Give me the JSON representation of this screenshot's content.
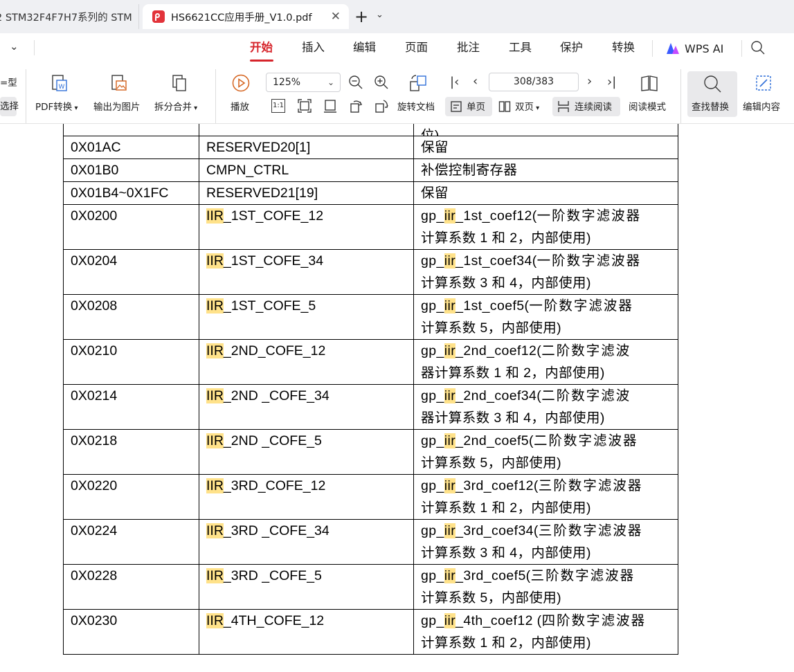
{
  "tabs": [
    {
      "label": "2 STM32F4F7H7系列的 STM",
      "active": false
    },
    {
      "label": "HS6621CC应用手册_V1.0.pdf",
      "active": true
    }
  ],
  "menu": [
    "开始",
    "插入",
    "编辑",
    "页面",
    "批注",
    "工具",
    "保护",
    "转换"
  ],
  "menu_active": "开始",
  "wps_ai": "WPS AI",
  "toolbar": {
    "left_cut_top": "=型",
    "left_cut_bottom": "选择",
    "pdf_convert": "PDF转换",
    "export_image": "输出为图片",
    "split_merge": "拆分合并",
    "play": "播放",
    "zoom": "125%",
    "rotate": "旋转文档",
    "page_indicator": "308/383",
    "single_page": "单页",
    "double_page": "双页",
    "continuous": "连续阅读",
    "read_mode": "阅读模式",
    "find_replace": "查找替换",
    "edit_content": "编辑内容",
    "actual_size": "1:1"
  },
  "cut_row_desc": "位)",
  "rows": [
    {
      "addr": "0X01AC",
      "name_hl": "",
      "name": "RESERVED20[1]",
      "d1": "保留",
      "hl": "",
      "d2": "",
      "d3": ""
    },
    {
      "addr": "0X01B0",
      "name_hl": "",
      "name": "CMPN_CTRL",
      "d1": "补偿控制寄存器",
      "hl": "",
      "d2": "",
      "d3": ""
    },
    {
      "addr": "0X01B4~0X1FC",
      "name_hl": "",
      "name": "RESERVED21[19]",
      "d1": "保留",
      "hl": "",
      "d2": "",
      "d3": ""
    },
    {
      "addr": "0X0200",
      "name_hl": "IIR",
      "name": "_1ST_COFE_12",
      "d1": "gp_",
      "hl": "iir",
      "d2": "_1st_coef12(",
      "d3": "一阶数字滤波器",
      "line2": "计算系数 1 和 2，内部使用)"
    },
    {
      "addr": "0X0204",
      "name_hl": "IIR",
      "name": "_1ST_COFE_34",
      "d1": "gp_",
      "hl": "iir",
      "d2": "_1st_coef34(",
      "d3": "一阶数字滤波器",
      "line2": "计算系数 3 和 4，内部使用)"
    },
    {
      "addr": "0X0208",
      "name_hl": "IIR",
      "name": "_1ST_COFE_5",
      "d1": "gp_",
      "hl": "iir",
      "d2": "_1st_coef5(",
      "d3": "一阶数字滤波器",
      "line2": "计算系数 5，内部使用)"
    },
    {
      "addr": "0X0210",
      "name_hl": "IIR",
      "name": "_2ND_COFE_12",
      "d1": "gp_",
      "hl": "iir",
      "d2": "_2nd_coef12(",
      "d3": "二阶数字滤波",
      "line2": "器计算系数 1 和 2，内部使用)"
    },
    {
      "addr": "0X0214",
      "name_hl": "IIR",
      "name": "_2ND _COFE_34",
      "d1": "gp_",
      "hl": "iir",
      "d2": "_2nd_coef34(",
      "d3": "二阶数字滤波",
      "line2": "器计算系数 3 和 4，内部使用)"
    },
    {
      "addr": "0X0218",
      "name_hl": "IIR",
      "name": "_2ND _COFE_5",
      "d1": "gp_",
      "hl": "iir",
      "d2": "_2nd_coef5(",
      "d3": "二阶数字滤波器",
      "line2": "计算系数 5，内部使用)"
    },
    {
      "addr": "0X0220",
      "name_hl": "IIR",
      "name": "_3RD_COFE_12",
      "d1": "gp_",
      "hl": "iir",
      "d2": "_3rd_coef12(",
      "d3": "三阶数字滤波器",
      "line2": "计算系数 1 和 2，内部使用)"
    },
    {
      "addr": "0X0224",
      "name_hl": "IIR",
      "name": "_3RD _COFE_34",
      "d1": "gp_",
      "hl": "iir",
      "d2": "_3rd_coef34(",
      "d3": "三阶数字滤波器",
      "line2": "计算系数 3 和 4，内部使用)"
    },
    {
      "addr": "0X0228",
      "name_hl": "IIR",
      "name": "_3RD _COFE_5",
      "d1": "gp_",
      "hl": "iir",
      "d2": "_3rd_coef5(",
      "d3": "三阶数字滤波器",
      "line2": "计算系数 5，内部使用)"
    },
    {
      "addr": "0X0230",
      "name_hl": "IIR",
      "name": "_4TH_COFE_12",
      "d1": "gp_",
      "hl": "iir",
      "d2": "_4th_coef12 (",
      "d3": "四阶数字滤波器",
      "line2": "计算系数 1 和 2，内部使用)"
    }
  ],
  "colors": {
    "accent": "#d6242b",
    "highlight": "#ffe28a",
    "tabbar": "#eff0f3"
  }
}
